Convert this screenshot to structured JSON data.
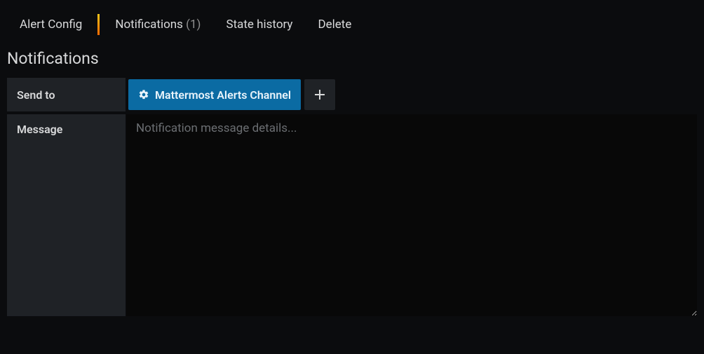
{
  "tabs": {
    "alert_config": "Alert Config",
    "notifications": "Notifications",
    "notifications_count": "(1)",
    "state_history": "State history",
    "delete": "Delete"
  },
  "section": {
    "title": "Notifications",
    "send_to_label": "Send to",
    "message_label": "Message",
    "message_placeholder": "Notification message details...",
    "message_value": ""
  },
  "channel": {
    "name": "Mattermost Alerts Channel"
  },
  "colors": {
    "accent": "#0b6ba3",
    "background": "#0b0c0e",
    "panel": "#1f2226"
  },
  "icons": {
    "gear": "gear-icon",
    "plus": "plus-icon"
  }
}
